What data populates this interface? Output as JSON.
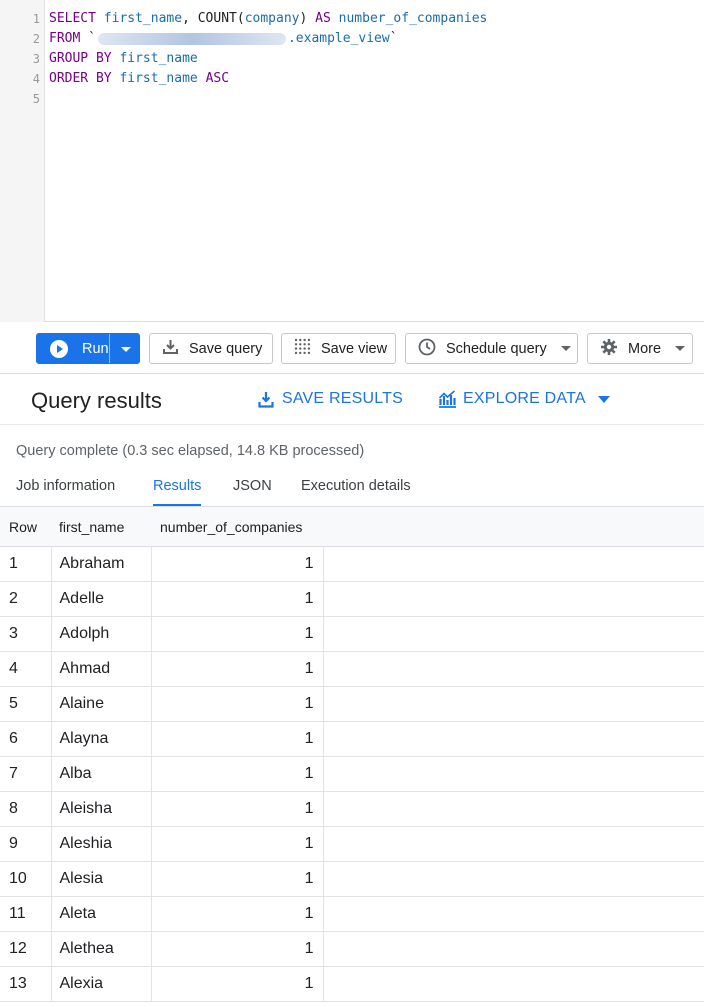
{
  "editor": {
    "line_numbers": [
      "1",
      "2",
      "3",
      "4",
      "5"
    ],
    "line1": {
      "kw1": "SELECT",
      "col1": "first_name",
      "plain1": ", COUNT(",
      "col2": "company",
      "plain2": ") ",
      "kw2": "AS",
      "alias": "number_of_companies"
    },
    "line2": {
      "kw1": "FROM",
      "tick_open": "`",
      "view": ".example_view",
      "tick_close": "`"
    },
    "line3": {
      "kw1": "GROUP BY",
      "col": "first_name"
    },
    "line4": {
      "kw1": "ORDER BY",
      "col": "first_name",
      "kw2": "ASC"
    }
  },
  "toolbar": {
    "run_label": "Run",
    "save_query_label": "Save query",
    "save_view_label": "Save view",
    "schedule_query_label": "Schedule query",
    "more_label": "More"
  },
  "results": {
    "title": "Query results",
    "save_results_label": "SAVE RESULTS",
    "explore_data_label": "EXPLORE DATA",
    "status": "Query complete (0.3 sec elapsed, 14.8 KB processed)",
    "tabs": [
      {
        "label": "Job information"
      },
      {
        "label": "Results"
      },
      {
        "label": "JSON"
      },
      {
        "label": "Execution details"
      }
    ],
    "columns": [
      "Row",
      "first_name",
      "number_of_companies"
    ],
    "rows": [
      [
        "1",
        "Abraham",
        "1"
      ],
      [
        "2",
        "Adelle",
        "1"
      ],
      [
        "3",
        "Adolph",
        "1"
      ],
      [
        "4",
        "Ahmad",
        "1"
      ],
      [
        "5",
        "Alaine",
        "1"
      ],
      [
        "6",
        "Alayna",
        "1"
      ],
      [
        "7",
        "Alba",
        "1"
      ],
      [
        "8",
        "Aleisha",
        "1"
      ],
      [
        "9",
        "Aleshia",
        "1"
      ],
      [
        "10",
        "Alesia",
        "1"
      ],
      [
        "11",
        "Aleta",
        "1"
      ],
      [
        "12",
        "Alethea",
        "1"
      ],
      [
        "13",
        "Alexia",
        "1"
      ]
    ]
  },
  "colors": {
    "accent": "#1a73e8",
    "keyword": "#770088",
    "identifier": "#1a6cb0"
  },
  "icons": [
    "play-icon",
    "dropdown-caret-icon",
    "download-icon",
    "grid-icon",
    "clock-icon",
    "gear-icon",
    "chart-icon"
  ]
}
